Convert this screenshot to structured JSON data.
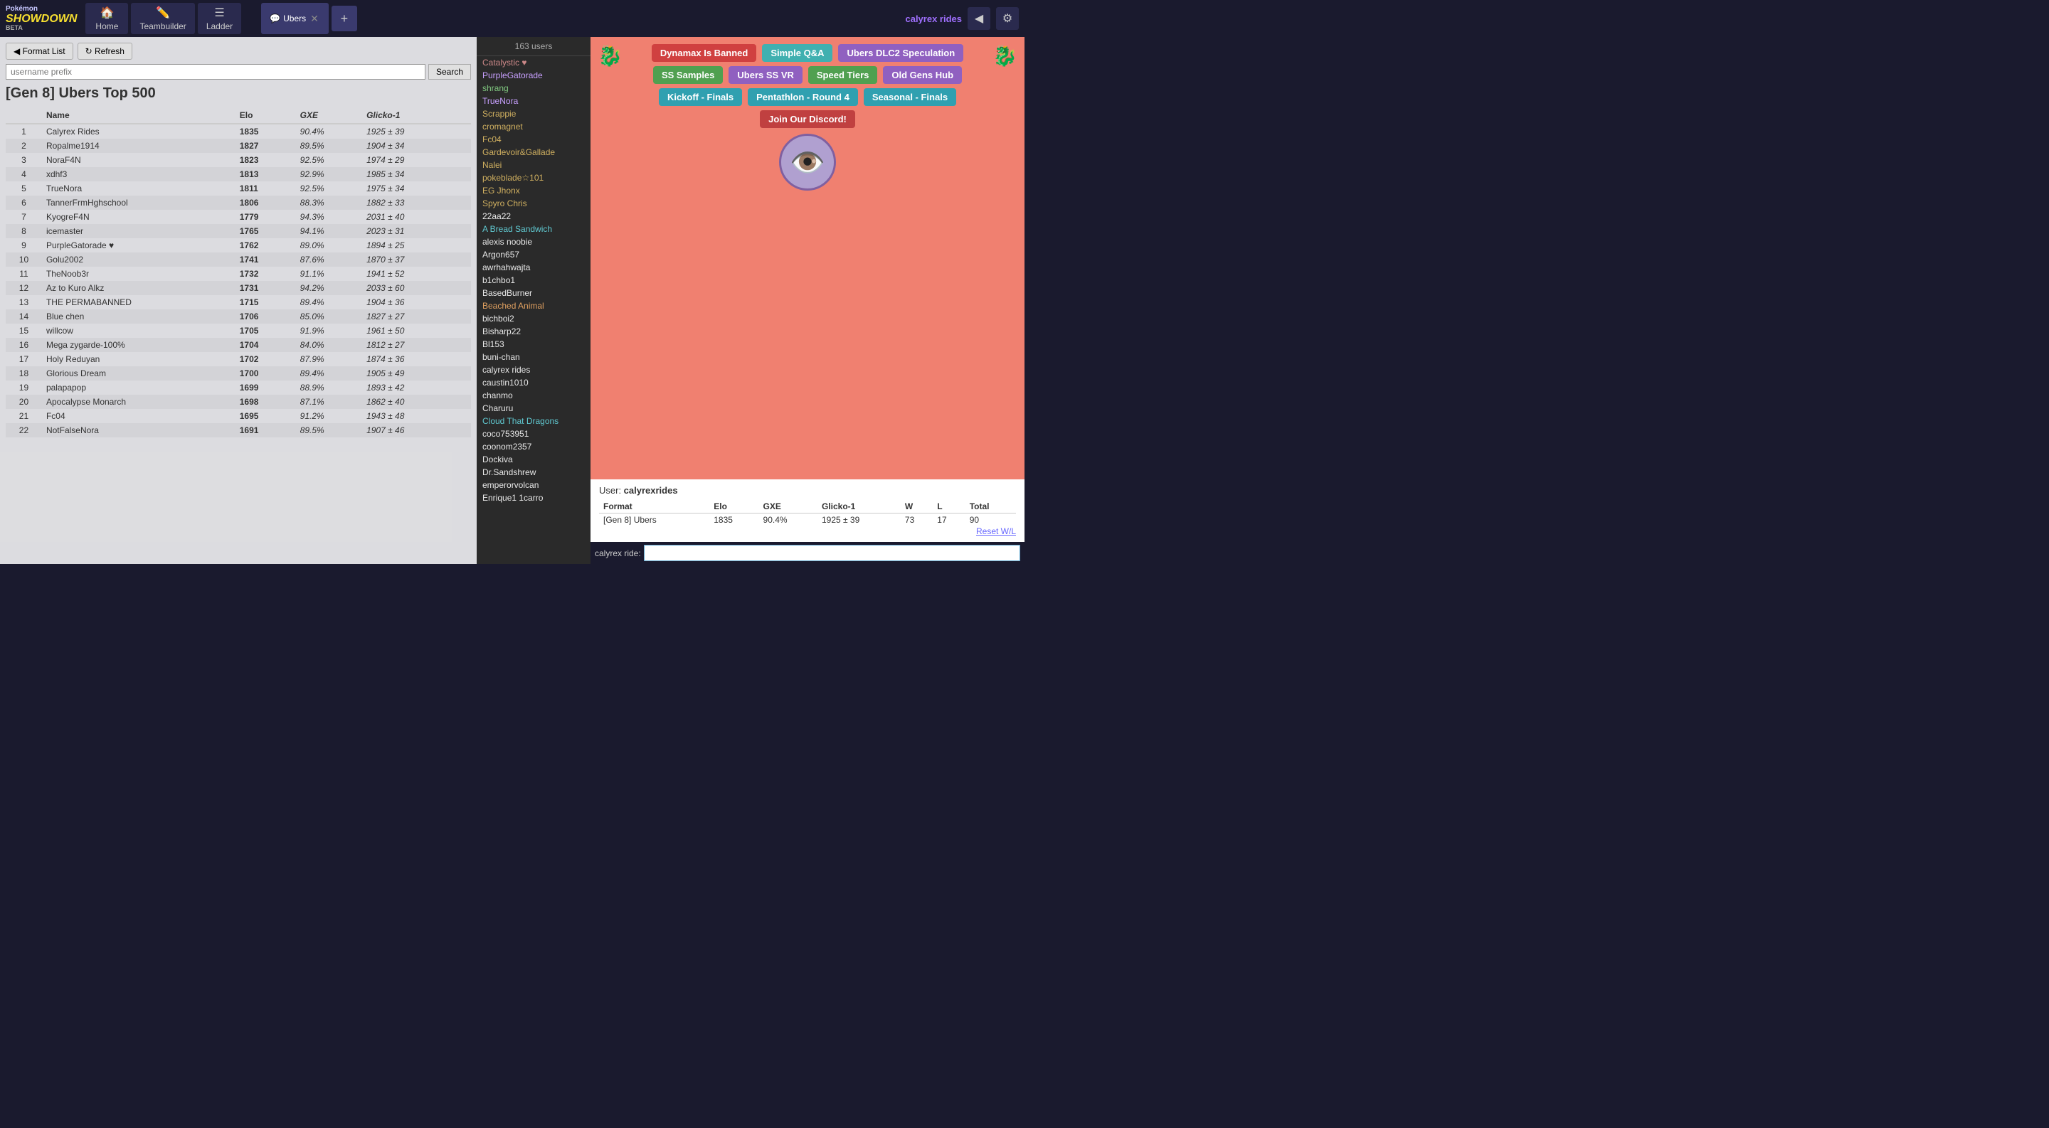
{
  "nav": {
    "logo_line1": "Pokémon",
    "logo_showdown": "SHOWDOWN",
    "logo_beta": "BETA",
    "home_label": "Home",
    "teambuilder_label": "Teambuilder",
    "ladder_label": "Ladder",
    "ubers_tab_label": "Ubers",
    "add_tab_label": "+",
    "username": "calyrex rides",
    "username_icon": "👤"
  },
  "toolbar": {
    "format_list_label": "◀ Format List",
    "refresh_label": "↻ Refresh",
    "search_placeholder": "username prefix",
    "search_button_label": "Search"
  },
  "ladder": {
    "title": "[Gen 8] Ubers Top 500",
    "columns": [
      "",
      "Name",
      "Elo",
      "GXE",
      "Glicko-1"
    ],
    "rows": [
      {
        "rank": 1,
        "name": "Calyrex Rides",
        "elo": "1835",
        "gxe": "90.4%",
        "glicko": "1925 ± 39"
      },
      {
        "rank": 2,
        "name": "Ropalme1914",
        "elo": "1827",
        "gxe": "89.5%",
        "glicko": "1904 ± 34"
      },
      {
        "rank": 3,
        "name": "NoraF4N",
        "elo": "1823",
        "gxe": "92.5%",
        "glicko": "1974 ± 29"
      },
      {
        "rank": 4,
        "name": "xdhf3",
        "elo": "1813",
        "gxe": "92.9%",
        "glicko": "1985 ± 34"
      },
      {
        "rank": 5,
        "name": "TrueNora",
        "elo": "1811",
        "gxe": "92.5%",
        "glicko": "1975 ± 34"
      },
      {
        "rank": 6,
        "name": "TannerFrmHghschool",
        "elo": "1806",
        "gxe": "88.3%",
        "glicko": "1882 ± 33"
      },
      {
        "rank": 7,
        "name": "KyogreF4N",
        "elo": "1779",
        "gxe": "94.3%",
        "glicko": "2031 ± 40"
      },
      {
        "rank": 8,
        "name": "icemaster",
        "elo": "1765",
        "gxe": "94.1%",
        "glicko": "2023 ± 31"
      },
      {
        "rank": 9,
        "name": "PurpleGatorade ♥",
        "elo": "1762",
        "gxe": "89.0%",
        "glicko": "1894 ± 25"
      },
      {
        "rank": 10,
        "name": "Golu2002",
        "elo": "1741",
        "gxe": "87.6%",
        "glicko": "1870 ± 37"
      },
      {
        "rank": 11,
        "name": "TheNoob3r",
        "elo": "1732",
        "gxe": "91.1%",
        "glicko": "1941 ± 52"
      },
      {
        "rank": 12,
        "name": "Az to Kuro Alkz",
        "elo": "1731",
        "gxe": "94.2%",
        "glicko": "2033 ± 60"
      },
      {
        "rank": 13,
        "name": "THE PERMABANNED",
        "elo": "1715",
        "gxe": "89.4%",
        "glicko": "1904 ± 36"
      },
      {
        "rank": 14,
        "name": "Blue chen",
        "elo": "1706",
        "gxe": "85.0%",
        "glicko": "1827 ± 27"
      },
      {
        "rank": 15,
        "name": "willcow",
        "elo": "1705",
        "gxe": "91.9%",
        "glicko": "1961 ± 50"
      },
      {
        "rank": 16,
        "name": "Mega zygarde-100%",
        "elo": "1704",
        "gxe": "84.0%",
        "glicko": "1812 ± 27"
      },
      {
        "rank": 17,
        "name": "Holy Reduyan",
        "elo": "1702",
        "gxe": "87.9%",
        "glicko": "1874 ± 36"
      },
      {
        "rank": 18,
        "name": "Glorious Dream",
        "elo": "1700",
        "gxe": "89.4%",
        "glicko": "1905 ± 49"
      },
      {
        "rank": 19,
        "name": "palapapop",
        "elo": "1699",
        "gxe": "88.9%",
        "glicko": "1893 ± 42"
      },
      {
        "rank": 20,
        "name": "Apocalypse Monarch",
        "elo": "1698",
        "gxe": "87.1%",
        "glicko": "1862 ± 40"
      },
      {
        "rank": 21,
        "name": "Fc04",
        "elo": "1695",
        "gxe": "91.2%",
        "glicko": "1943 ± 48"
      },
      {
        "rank": 22,
        "name": "NotFalseNora",
        "elo": "1691",
        "gxe": "89.5%",
        "glicko": "1907 ± 46"
      }
    ]
  },
  "users": {
    "count": "163 users",
    "list": [
      {
        "name": "Catalystic ♥",
        "class": "user-staff"
      },
      {
        "name": "PurpleGatorade",
        "class": "user-purple"
      },
      {
        "name": "shrang",
        "class": "user-green"
      },
      {
        "name": "TrueNora",
        "class": "user-purple"
      },
      {
        "name": "Scrappie",
        "class": "user-yellow"
      },
      {
        "name": "cromagnet",
        "class": "user-yellow"
      },
      {
        "name": "Fc04",
        "class": "user-yellow"
      },
      {
        "name": "Gardevoir&Gallade",
        "class": "user-yellow"
      },
      {
        "name": "Nalei",
        "class": "user-yellow"
      },
      {
        "name": "pokeblade☆101",
        "class": "user-yellow"
      },
      {
        "name": "EG Jhonx",
        "class": "user-yellow"
      },
      {
        "name": "Spyro Chris",
        "class": "user-yellow"
      },
      {
        "name": "22aa22",
        "class": "user-white"
      },
      {
        "name": "A Bread Sandwich",
        "class": "user-cyan"
      },
      {
        "name": "alexis noobie",
        "class": "user-white"
      },
      {
        "name": "Argon657",
        "class": "user-white"
      },
      {
        "name": "awrhahwajta",
        "class": "user-white"
      },
      {
        "name": "b1chbo1",
        "class": "user-white"
      },
      {
        "name": "BasedBurner",
        "class": "user-white"
      },
      {
        "name": "Beached Animal",
        "class": "user-orange"
      },
      {
        "name": "bichboi2",
        "class": "user-white"
      },
      {
        "name": "Bisharp22",
        "class": "user-white"
      },
      {
        "name": "Bl153",
        "class": "user-white"
      },
      {
        "name": "buni-chan",
        "class": "user-white"
      },
      {
        "name": "calyrex rides",
        "class": "user-white"
      },
      {
        "name": "caustin1010",
        "class": "user-white"
      },
      {
        "name": "chanmo",
        "class": "user-white"
      },
      {
        "name": "Charuru",
        "class": "user-white"
      },
      {
        "name": "Cloud That Dragons",
        "class": "user-cyan"
      },
      {
        "name": "coco753951",
        "class": "user-white"
      },
      {
        "name": "coonom2357",
        "class": "user-white"
      },
      {
        "name": "Dockiva",
        "class": "user-white"
      },
      {
        "name": "Dr.Sandshrew",
        "class": "user-white"
      },
      {
        "name": "emperorvolcan",
        "class": "user-white"
      },
      {
        "name": "Enrique1 1carro",
        "class": "user-white"
      }
    ]
  },
  "room": {
    "mascot_left": "🐉",
    "mascot_right": "🐉",
    "mascot_center": "👁️",
    "buttons": [
      {
        "label": "Dynamax Is Banned",
        "class": "btn-red"
      },
      {
        "label": "Simple Q&A",
        "class": "btn-teal"
      },
      {
        "label": "Ubers DLC2 Speculation",
        "class": "btn-purple"
      },
      {
        "label": "SS Samples",
        "class": "btn-green"
      },
      {
        "label": "Ubers SS VR",
        "class": "btn-purple"
      },
      {
        "label": "Speed Tiers",
        "class": "btn-green"
      },
      {
        "label": "Old Gens Hub",
        "class": "btn-purple"
      },
      {
        "label": "Kickoff - Finals",
        "class": "btn-cyan"
      },
      {
        "label": "Pentathlon - Round 4",
        "class": "btn-cyan"
      },
      {
        "label": "Seasonal - Finals",
        "class": "btn-cyan"
      },
      {
        "label": "Join Our Discord!",
        "class": "btn-discord"
      }
    ]
  },
  "user_stats": {
    "label": "User:",
    "username": "calyrexrides",
    "columns": [
      "Format",
      "Elo",
      "GXE",
      "Glicko-1",
      "W",
      "L",
      "Total"
    ],
    "row": {
      "format": "[Gen 8] Ubers",
      "elo": "1835",
      "gxe": "90.4%",
      "glicko": "1925 ± 39",
      "w": "73",
      "l": "17",
      "total": "90"
    },
    "reset_label": "Reset W/L"
  },
  "chat": {
    "prefix": "calyrex ride:",
    "input_placeholder": ""
  }
}
